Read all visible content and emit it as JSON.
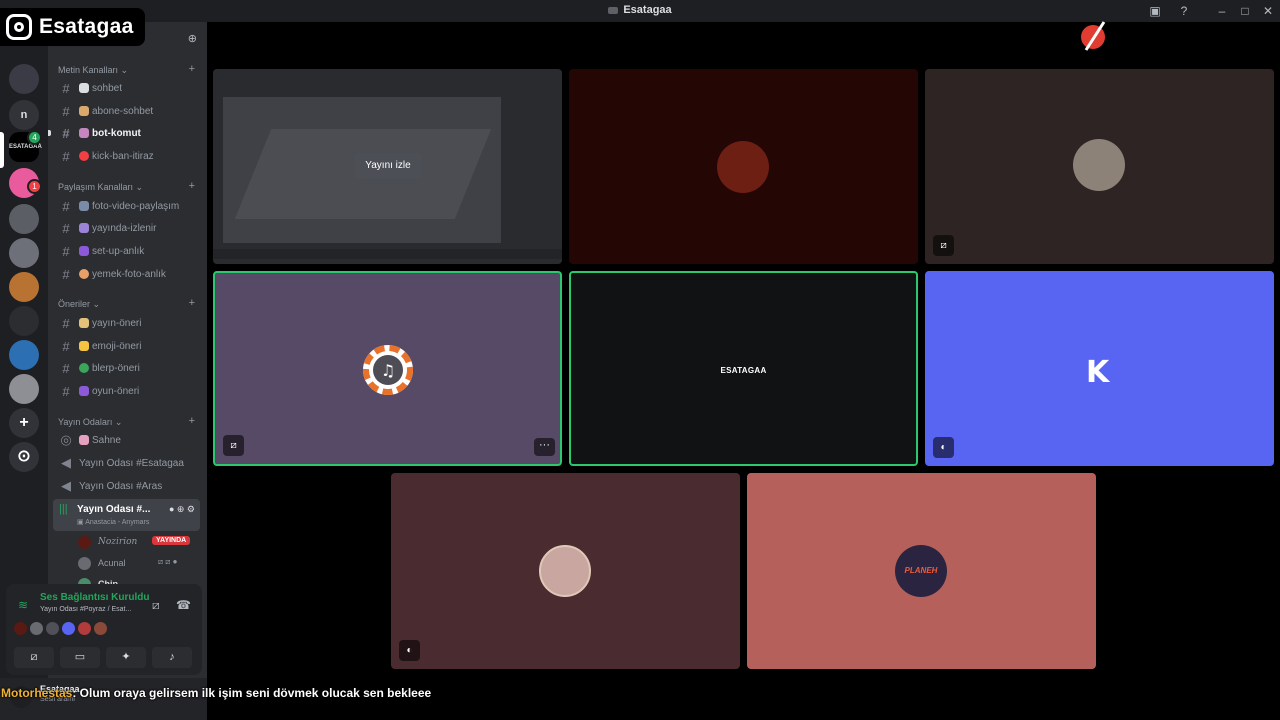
{
  "window": {
    "title": "Esatagaa"
  },
  "overlay": {
    "brand": "Esatagaa"
  },
  "servers": {
    "n_label": "n",
    "esatagaa_label": "ESATAGAA",
    "esatagaa_badge": "4",
    "pink_badge": "1",
    "add_icon": "+",
    "explore_icon": "⊙"
  },
  "sidebar": {
    "categories": [
      {
        "name": "Metin Kanalları",
        "channels": [
          "sohbet",
          "abone-sohbet",
          "bot-komut",
          "kick-ban-itiraz"
        ]
      },
      {
        "name": "Paylaşım Kanalları",
        "channels": [
          "foto-video-paylaşım",
          "yayında-izlenir",
          "set-up-anlık",
          "yemek-foto-anlık"
        ]
      },
      {
        "name": "Öneriler",
        "channels": [
          "yayın-öneri",
          "emoji-öneri",
          "blerp-öneri",
          "oyun-öneri"
        ]
      },
      {
        "name": "Yayın Odaları",
        "channels": [
          "Sahne",
          "Yayın Odası #Esatagaa",
          "Yayın Odası #Aras"
        ]
      }
    ],
    "active_voice": {
      "name": "Yayın Odası #...",
      "activity": "Anastacia - Anymars"
    },
    "voice_users": [
      {
        "name": "Nozirion",
        "badge": "YAYINDA"
      },
      {
        "name": "Acunal"
      },
      {
        "name": "Chip"
      }
    ]
  },
  "voice_panel": {
    "status": "Ses Bağlantısı Kuruldu",
    "channel": "Yayın Odası #Poyraz / Esat..."
  },
  "user": {
    "name": "Esatagaa",
    "status": "Sesli aramı"
  },
  "chat_caption": {
    "author": "Motorhestas",
    "text": ": Olum oraya gelirsem ilk işim seni dövmek olucak sen bekleee"
  },
  "stage": {
    "watch_stream": "Yayını izle",
    "esatagaa_tile": "ESATAGAA",
    "kick_letter": "K",
    "planeh_label": "PLANEH"
  },
  "colors": {
    "speaking": "#2dc770",
    "live": "#da373c",
    "kick_tile": "#5865f2",
    "voice_connected": "#23a55a"
  }
}
